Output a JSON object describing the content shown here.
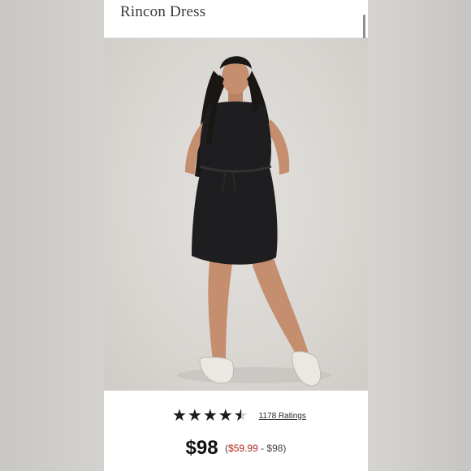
{
  "product": {
    "title": "Rincon Dress"
  },
  "carousel": {
    "dot_count": 8,
    "active_index": 3
  },
  "rating": {
    "stars": 4.5,
    "stars_glyphs": "★★★★★",
    "count_label": "1178 Ratings"
  },
  "price": {
    "main": "$98",
    "range_open": "(",
    "sale_low": "$59.99",
    "range_rest": " - $98)"
  },
  "colors": {
    "sale": "#b3261e",
    "text": "#111111",
    "dress": "#1e1e20"
  }
}
